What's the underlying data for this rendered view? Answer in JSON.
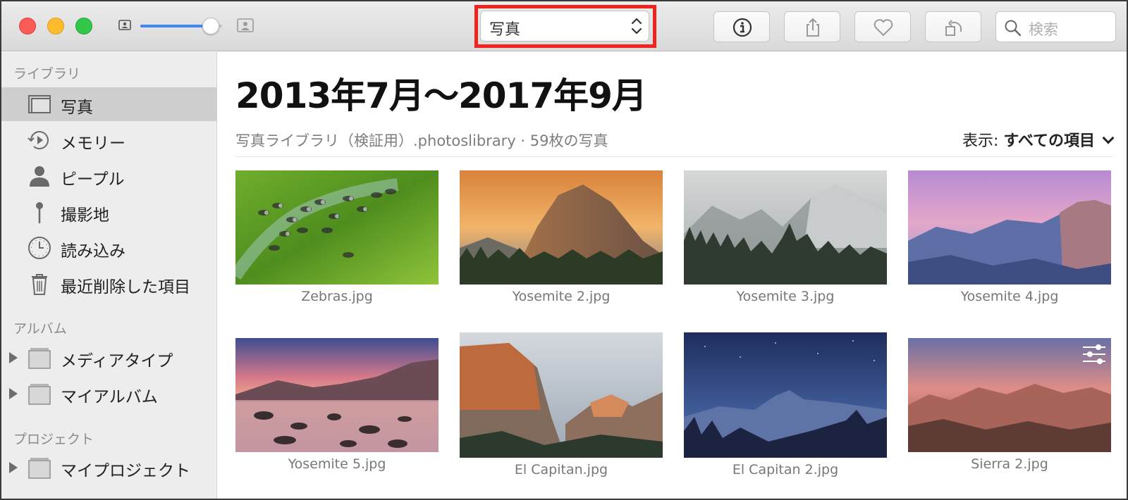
{
  "toolbar": {
    "view_select_value": "写真",
    "search_placeholder": "検索",
    "zoom_level": 0.86
  },
  "sidebar": {
    "sections": {
      "library": "ライブラリ",
      "albums": "アルバム",
      "projects": "プロジェクト"
    },
    "library_items": [
      {
        "label": "写真",
        "icon": "photos-icon",
        "selected": true
      },
      {
        "label": "メモリー",
        "icon": "memories-icon"
      },
      {
        "label": "ピープル",
        "icon": "people-icon"
      },
      {
        "label": "撮影地",
        "icon": "places-pin-icon"
      },
      {
        "label": "読み込み",
        "icon": "imports-clock-icon"
      },
      {
        "label": "最近削除した項目",
        "icon": "trash-icon"
      }
    ],
    "album_items": [
      {
        "label": "メディアタイプ",
        "icon": "folder-icon"
      },
      {
        "label": "マイアルバム",
        "icon": "folder-icon"
      }
    ],
    "project_items": [
      {
        "label": "マイプロジェクト",
        "icon": "folder-icon"
      }
    ]
  },
  "main": {
    "title": "2013年7月〜2017年9月",
    "subtitle": "写真ライブラリ（検証用）.photoslibrary · 59枚の写真",
    "filter_label": "表示:",
    "filter_value": "すべての項目",
    "photos": [
      {
        "caption": "Zebras.jpg"
      },
      {
        "caption": "Yosemite 2.jpg"
      },
      {
        "caption": "Yosemite 3.jpg"
      },
      {
        "caption": "Yosemite 4.jpg"
      },
      {
        "caption": "Yosemite 5.jpg"
      },
      {
        "caption": "El Capitan.jpg"
      },
      {
        "caption": "El Capitan 2.jpg"
      },
      {
        "caption": "Sierra 2.jpg",
        "edited": true
      }
    ]
  },
  "colors": {
    "highlight_box": "#f0231d",
    "slider_accent": "#3f86f7",
    "sidebar_selected": "#cfcfcf"
  }
}
